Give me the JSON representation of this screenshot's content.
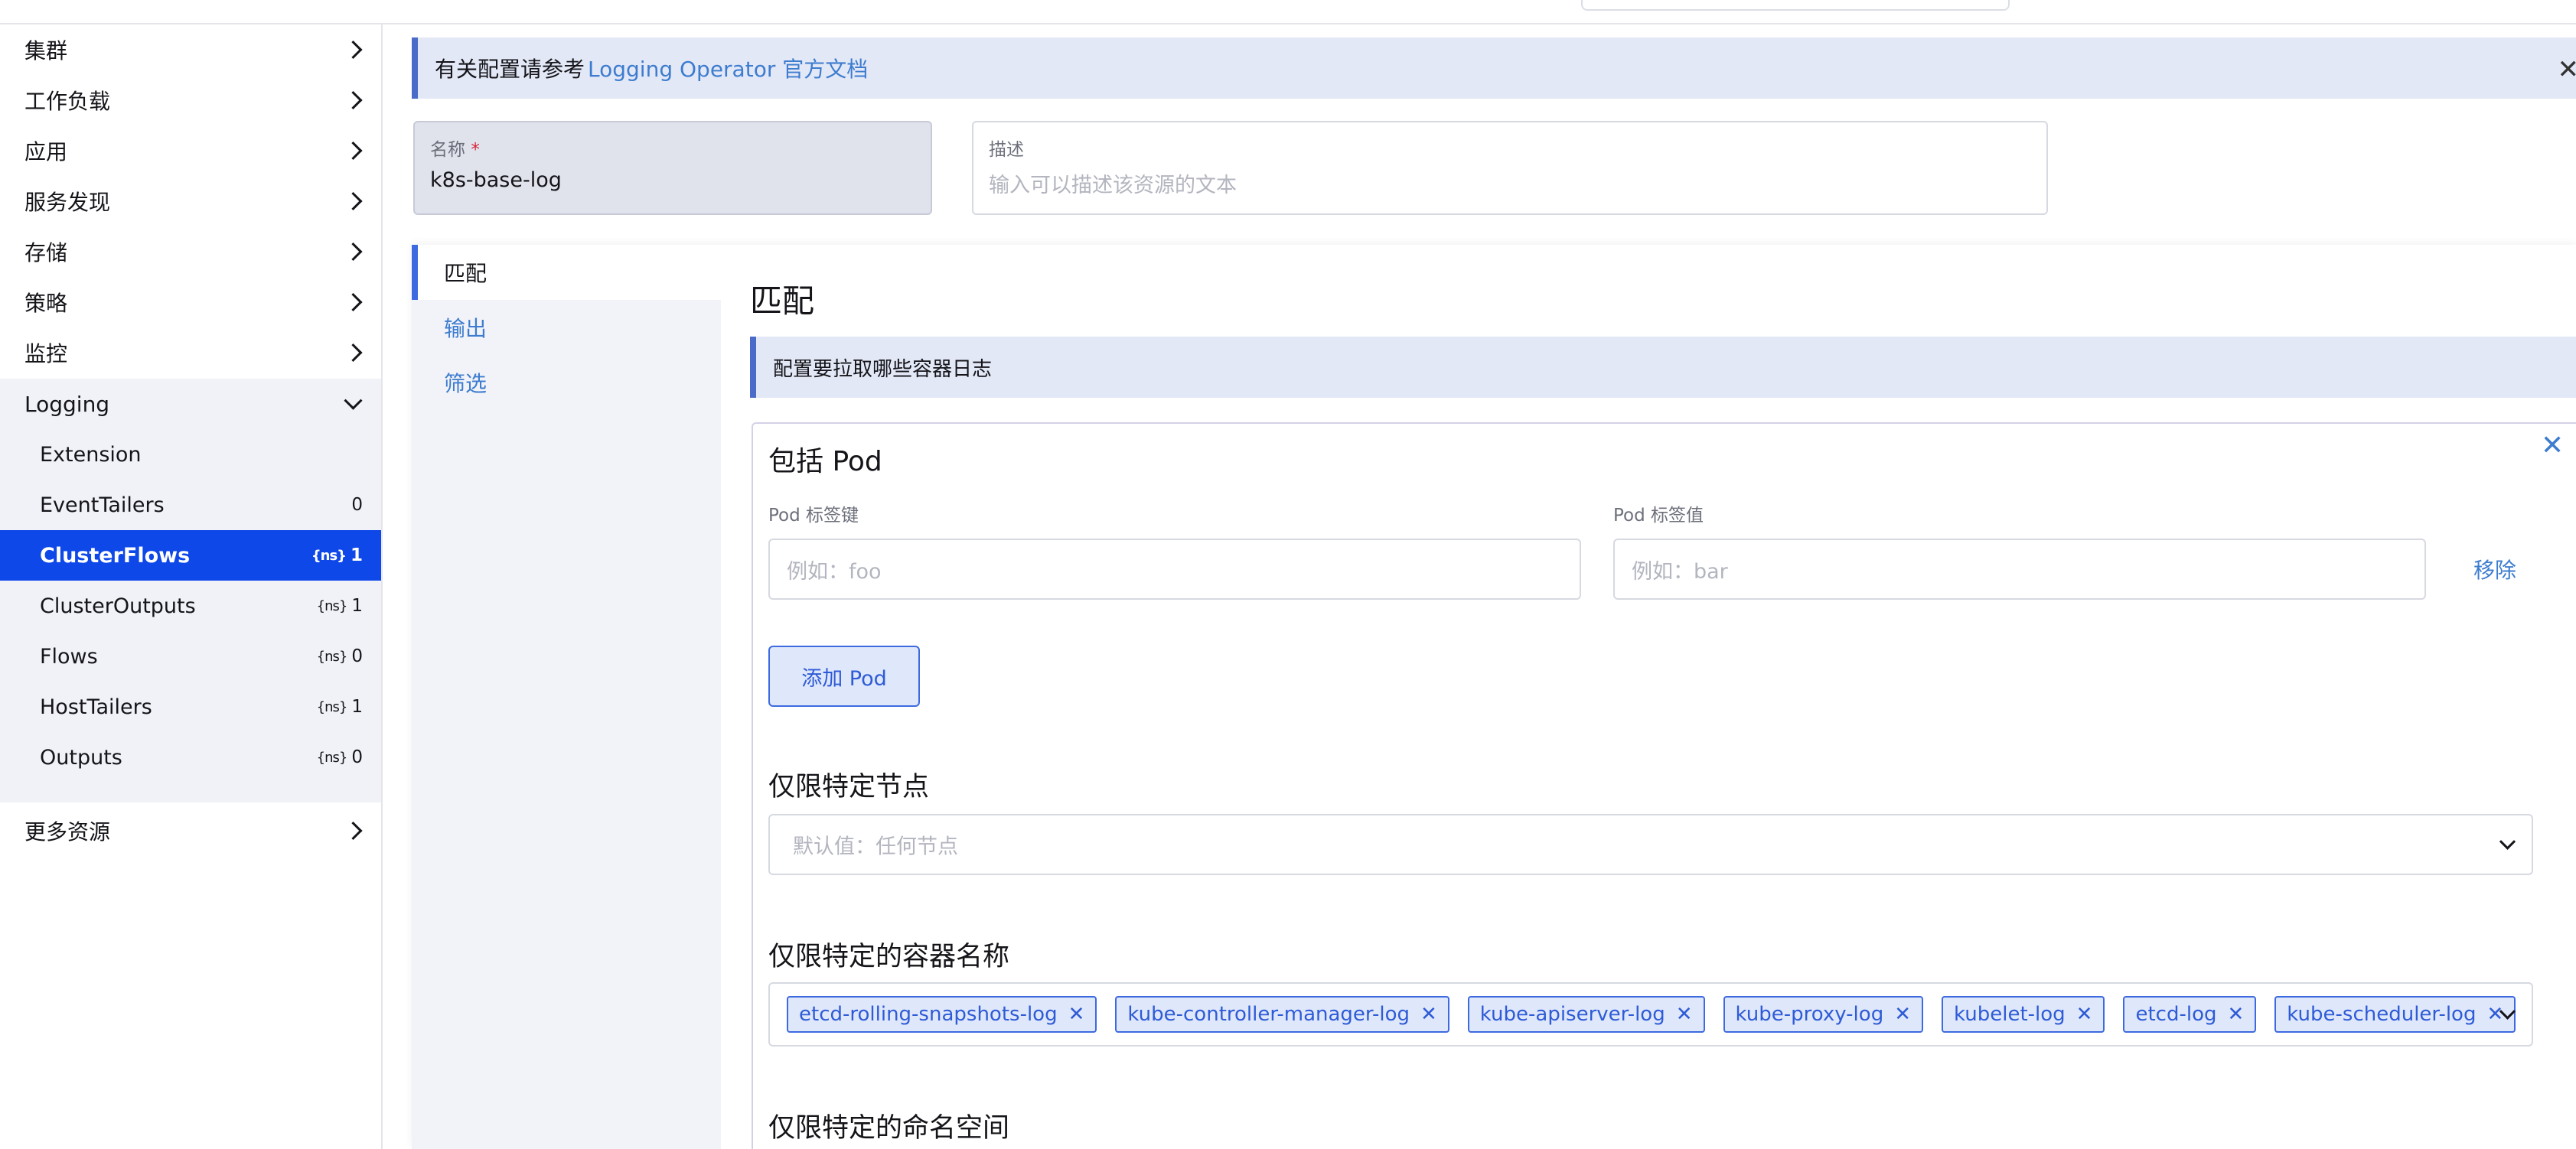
{
  "sidebar": {
    "items_top": [
      {
        "label": "集群"
      },
      {
        "label": "工作负载"
      },
      {
        "label": "应用"
      },
      {
        "label": "服务发现"
      },
      {
        "label": "存储"
      },
      {
        "label": "策略"
      },
      {
        "label": "监控"
      }
    ],
    "logging": {
      "label": "Logging",
      "children": [
        {
          "label": "Extension",
          "count": ""
        },
        {
          "label": "EventTailers",
          "count": "0"
        },
        {
          "label": "ClusterFlows",
          "count": "1",
          "ns_icon": "{ns}"
        },
        {
          "label": "ClusterOutputs",
          "count": "1",
          "ns_icon": "{ns}"
        },
        {
          "label": "Flows",
          "count": "0",
          "ns_icon": "{ns}"
        },
        {
          "label": "HostTailers",
          "count": "1",
          "ns_icon": "{ns}"
        },
        {
          "label": "Outputs",
          "count": "0",
          "ns_icon": "{ns}"
        }
      ]
    },
    "more": {
      "label": "更多资源"
    }
  },
  "banner": {
    "text": "有关配置请参考",
    "link": "Logging Operator 官方文档",
    "close": "✕"
  },
  "form": {
    "name_label": "名称",
    "name_required": "*",
    "name_value": "k8s-base-log",
    "desc_label": "描述",
    "desc_placeholder": "输入可以描述该资源的文本"
  },
  "tabs": [
    {
      "label": "匹配"
    },
    {
      "label": "输出"
    },
    {
      "label": "筛选"
    }
  ],
  "match": {
    "title": "匹配",
    "info": "配置要拉取哪些容器日志",
    "card": {
      "title": "包括 Pod",
      "close": "✕",
      "key_label": "Pod 标签键",
      "key_placeholder": "例如：foo",
      "value_label": "Pod 标签值",
      "value_placeholder": "例如：bar",
      "remove": "移除",
      "add_button": "添加 Pod",
      "nodes_title": "仅限特定节点",
      "nodes_placeholder": "默认值：任何节点",
      "containers_title": "仅限特定的容器名称",
      "containers": [
        "etcd-rolling-snapshots-log",
        "kube-controller-manager-log",
        "kube-apiserver-log",
        "kube-proxy-log",
        "kubelet-log",
        "etcd-log",
        "kube-scheduler-log"
      ],
      "namespaces_title": "仅限特定的命名空间"
    }
  },
  "colors": {
    "accent": "#0f48e8",
    "link": "#3d7ccf",
    "info_bg": "#e3e8f6"
  }
}
